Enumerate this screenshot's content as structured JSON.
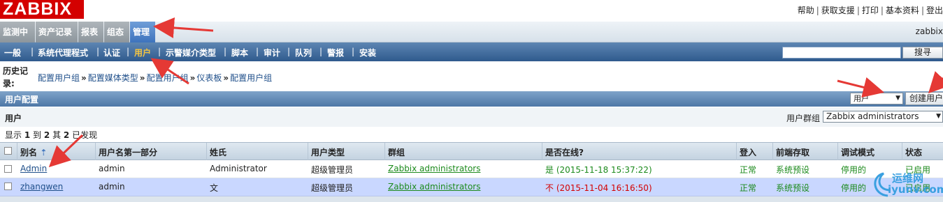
{
  "app": {
    "logo": "ZABBIX"
  },
  "top_links": [
    "帮助",
    "获取支援",
    "打印",
    "基本资料",
    "登出"
  ],
  "main_menu": {
    "items": [
      "监测中",
      "资产记录",
      "报表",
      "组态",
      "管理"
    ],
    "active": "管理",
    "user": "zabbix"
  },
  "sub_menu": {
    "items": [
      "一般",
      "系统代理程式",
      "认证",
      "用户",
      "示警媒介类型",
      "脚本",
      "审计",
      "队列",
      "警报",
      "安装"
    ],
    "active": "用户"
  },
  "search": {
    "value": "",
    "button": "搜寻"
  },
  "history": {
    "label": "历史记录:",
    "crumbs": [
      "配置用户组",
      "配置媒体类型",
      "配置用户组",
      "仪表板",
      "配置用户组"
    ]
  },
  "config_bar": {
    "title": "用户配置",
    "type_select": "用户",
    "create_button": "创建用户"
  },
  "users_section": {
    "title": "用户",
    "group_label": "用户群组",
    "group_select": "Zabbix administrators"
  },
  "count": {
    "prefix": "显示",
    "from": "1",
    "to_word": "到",
    "to": "2",
    "of_word": "其",
    "total": "2",
    "suffix": "已发现"
  },
  "table": {
    "headers": [
      "别名",
      "用户名第一部分",
      "姓氏",
      "用户类型",
      "群组",
      "是否在线?",
      "登入",
      "前端存取",
      "调试模式",
      "状态"
    ],
    "rows": [
      {
        "alias": "Admin",
        "name": "admin",
        "surname": "Administrator",
        "type": "超级管理员",
        "group": "Zabbix administrators",
        "online": "是 (2015-11-18 15:37:22)",
        "login": "正常",
        "frontend": "系统预设",
        "debug": "停用的",
        "status": "已启用"
      },
      {
        "alias": "zhangwen",
        "name": "admin",
        "surname": "文",
        "type": "超级管理员",
        "group": "Zabbix administrators",
        "online": "不 (2015-11-04 16:16:50)",
        "login": "正常",
        "frontend": "系统预设",
        "debug": "停用的",
        "status": "已启用"
      }
    ]
  },
  "watermark": {
    "text": "运维网",
    "sub": "iyunv.com"
  },
  "colors": {
    "logo": "#d40000",
    "active_menu": "#3d73bd",
    "submenu": "#2f5a8d",
    "active_submenu_text": "#f4c542",
    "selected_row": "#c9d7ff",
    "online_yes": "#1c8a1c",
    "online_no": "#d40000",
    "annotation_arrow": "#e53935"
  }
}
